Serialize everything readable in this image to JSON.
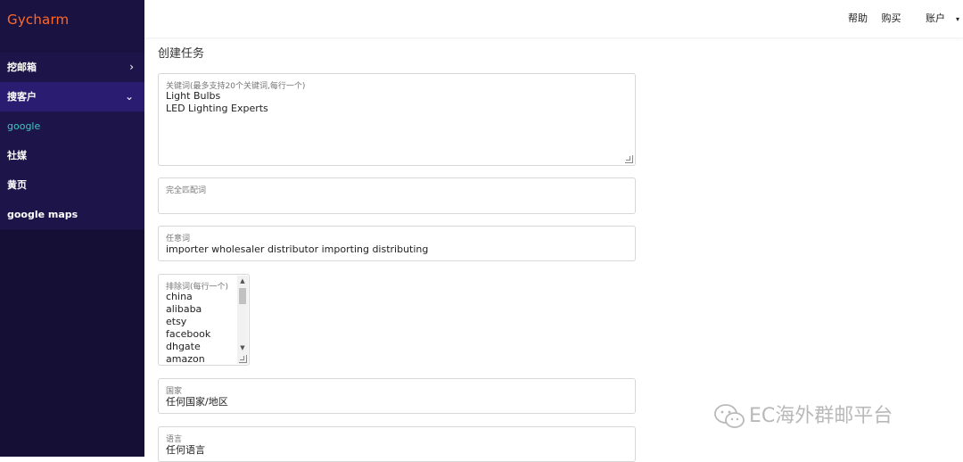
{
  "brand": "Gycharm",
  "sidebar": {
    "items": [
      {
        "label": "挖邮箱",
        "chevron": "›"
      },
      {
        "label": "搜客户",
        "chevron": "⌄"
      },
      {
        "label": "google"
      },
      {
        "label": "社媒"
      },
      {
        "label": "黄页"
      },
      {
        "label": "google maps"
      }
    ]
  },
  "topnav": {
    "help": "帮助",
    "buy": "购买",
    "account": "账户",
    "account_caret": "▾"
  },
  "page": {
    "title": "创建任务"
  },
  "form": {
    "keywords": {
      "label": "关键词(最多支持20个关键词,每行一个)",
      "value": "Light Bulbs\nLED Lighting Experts"
    },
    "exact_match": {
      "label": "完全匹配词",
      "value": ""
    },
    "any_words": {
      "label": "任意词",
      "value": "importer wholesaler distributor importing distributing"
    },
    "exclude": {
      "label": "排除词(每行一个)",
      "items": [
        "china",
        "alibaba",
        "etsy",
        "facebook",
        "dhgate",
        "amazon"
      ]
    },
    "country": {
      "label": "国家",
      "value": "任何国家/地区"
    },
    "language": {
      "label": "语言",
      "value": "任何语言"
    }
  },
  "watermark": {
    "text": "EC海外群邮平台"
  },
  "icons": {
    "scroll_up": "▲",
    "scroll_down": "▼"
  }
}
